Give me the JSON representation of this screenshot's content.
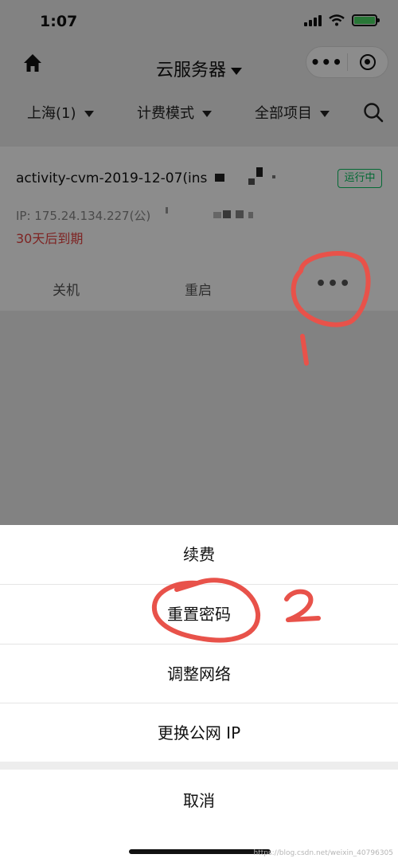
{
  "status_bar": {
    "time": "1:07"
  },
  "nav": {
    "title": "云服务器"
  },
  "filters": {
    "region": "上海(1)",
    "billing": "计费模式",
    "project": "全部项目"
  },
  "instance": {
    "name": "activity-cvm-2019-12-07(ins",
    "status": "运行中",
    "ip": "IP: 175.24.134.227(公)",
    "expiry": "30天后到期",
    "actions": {
      "shutdown": "关机",
      "restart": "重启"
    }
  },
  "action_sheet": {
    "items": [
      "续费",
      "重置密码",
      "调整网络",
      "更换公网 IP"
    ],
    "cancel": "取消"
  },
  "watermark": "https://blog.csdn.net/weixin_40796305",
  "colors": {
    "running_green": "#07c160",
    "expiry_red": "#e64340",
    "annotation_red": "#e8524a"
  },
  "icons": [
    "home-icon",
    "more-dots-icon",
    "target-icon",
    "search-icon",
    "signal-icon",
    "wifi-icon",
    "battery-icon"
  ]
}
